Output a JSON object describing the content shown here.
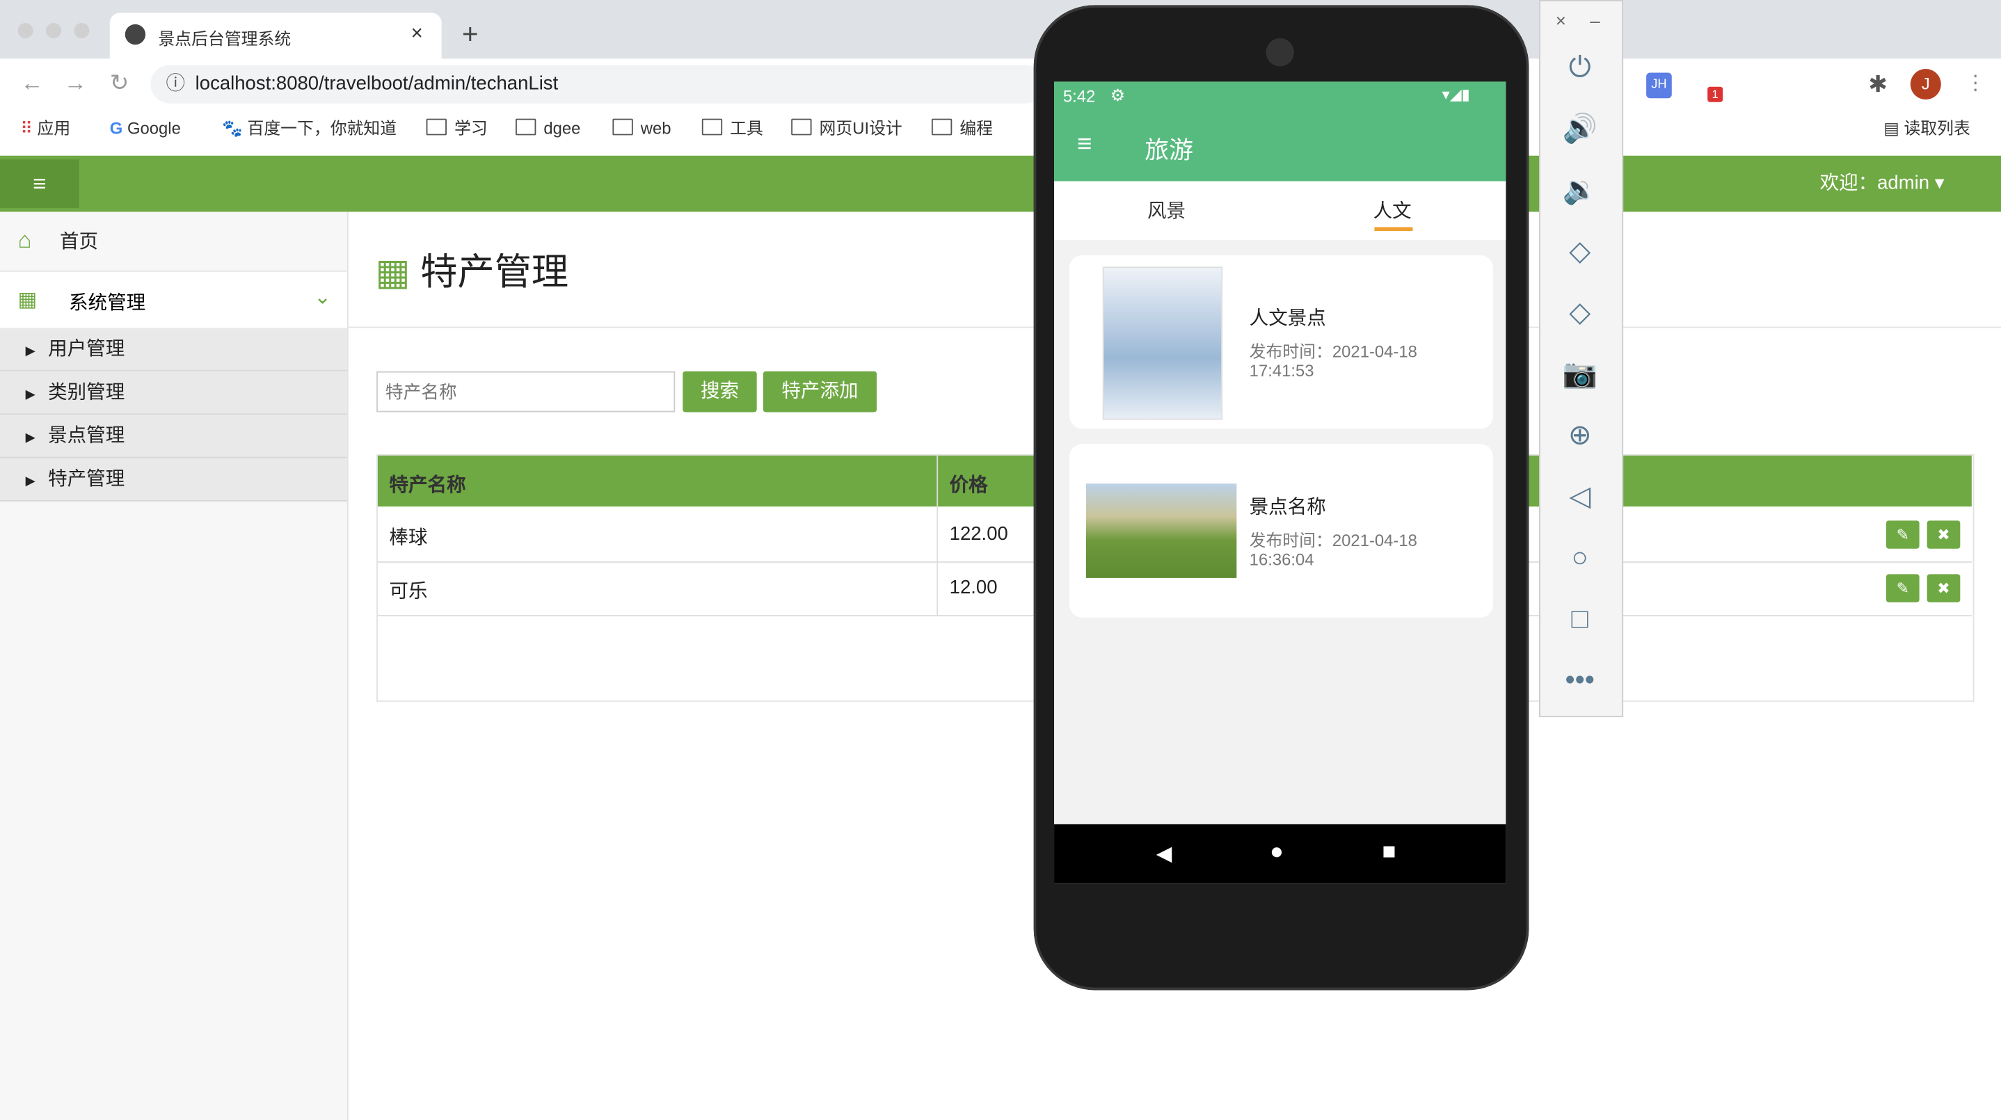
{
  "browser": {
    "tab_title": "景点后台管理系统",
    "url": "localhost:8080/travelboot/admin/techanList",
    "bookmarks": [
      "应用",
      "Google",
      "百度一下，你就知道",
      "学习",
      "dgee",
      "web",
      "工具",
      "网页UI设计",
      "编程"
    ],
    "reading_list": "读取列表",
    "profile_initial": "J",
    "ext_badge": "1"
  },
  "header": {
    "welcome": "欢迎：admin"
  },
  "sidebar": {
    "home": "首页",
    "system": "系统管理",
    "items": [
      "用户管理",
      "类别管理",
      "景点管理",
      "特产管理"
    ]
  },
  "main": {
    "title": "特产管理",
    "search_placeholder": "特产名称",
    "search_btn": "搜索",
    "add_btn": "特产添加",
    "columns": [
      "特产名称",
      "价格"
    ],
    "rows": [
      {
        "name": "棒球",
        "price": "122.00"
      },
      {
        "name": "可乐",
        "price": "12.00"
      }
    ]
  },
  "phone": {
    "time": "5:42",
    "app_title": "旅游",
    "tabs": [
      "风景",
      "人文"
    ],
    "active_tab": "人文",
    "cards": [
      {
        "title": "人文景点",
        "date_label": "发布时间：2021-04-18",
        "time": "17:41:53"
      },
      {
        "title": "景点名称",
        "date_label": "发布时间：2021-04-18",
        "time": "16:36:04"
      }
    ]
  },
  "colors": {
    "admin_green": "#6fa943",
    "app_green": "#57bb7f",
    "tab_underline": "#f0a030"
  }
}
